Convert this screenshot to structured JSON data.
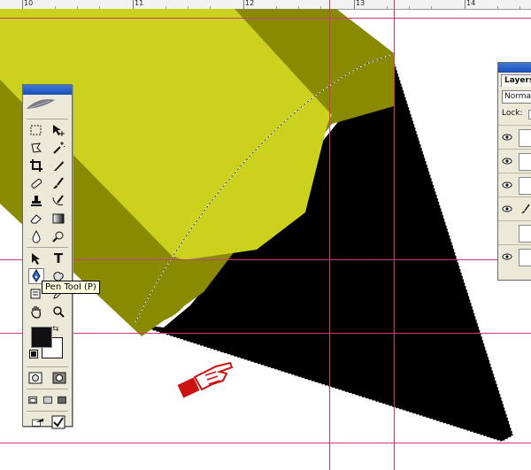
{
  "ruler": {
    "numbers": [
      "10",
      "11",
      "12",
      "13",
      "14"
    ]
  },
  "tools_panel": {
    "tooltip": "Pen Tool (P)",
    "active_tool": "pen-tool",
    "foreground_color": "#111111",
    "background_color": "#ffffff"
  },
  "layers_panel": {
    "tab_label": "Layers",
    "blend_mode": "Normal",
    "lock_label": "Lock:"
  },
  "colors": {
    "shape_light": "#ccd11e",
    "shape_dark": "#8a8a00",
    "shadow": "#000000",
    "guides": "#d2357a",
    "cursor": "#cc1111"
  }
}
